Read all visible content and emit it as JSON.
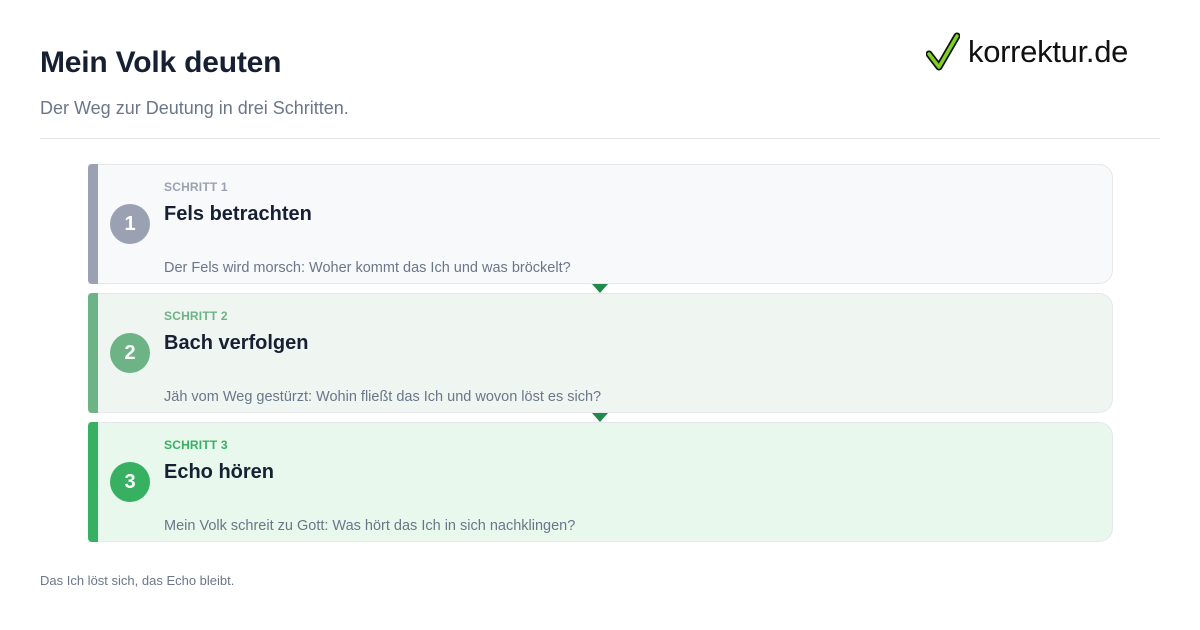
{
  "header": {
    "title": "Mein Volk deuten",
    "subtitle": "Der Weg zur Deutung in drei Schritten."
  },
  "logo": {
    "icon": "checkmark-icon",
    "text": "korrektur.de",
    "icon_color": "#7ed321"
  },
  "steps": [
    {
      "number": "1",
      "kicker": "SCHRITT 1",
      "title": "Fels betrachten",
      "description": "Der Fels wird morsch: Woher kommt das Ich und was bröckelt?",
      "color": "#9aa1b2"
    },
    {
      "number": "2",
      "kicker": "SCHRITT 2",
      "title": "Bach verfolgen",
      "description": "Jäh vom Weg gestürzt: Wohin fließt das Ich und wovon löst es sich?",
      "color": "#6db386"
    },
    {
      "number": "3",
      "kicker": "SCHRITT 3",
      "title": "Echo hören",
      "description": "Mein Volk schreit zu Gott: Was hört das Ich in sich nachklingen?",
      "color": "#37b062"
    }
  ],
  "connector_color": "#1f8a4a",
  "footer": {
    "note": "Das Ich löst sich, das Echo bleibt."
  }
}
